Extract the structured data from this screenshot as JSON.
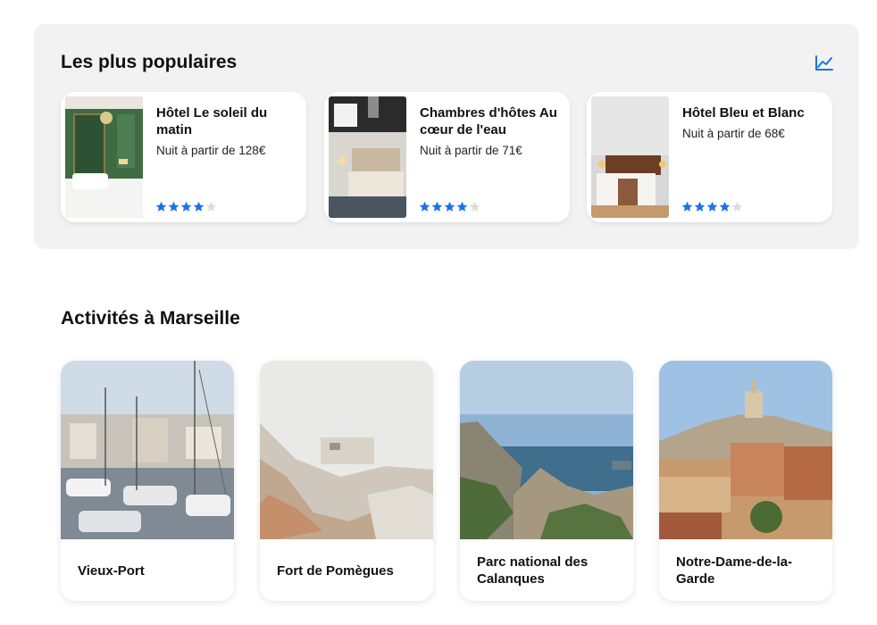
{
  "popular": {
    "title": "Les plus populaires",
    "chart_icon": "chart-line-icon",
    "hotels": [
      {
        "name": "Hôtel Le soleil du matin",
        "price": "Nuit à partir de 128€",
        "stars": 4,
        "max_stars": 5
      },
      {
        "name": "Chambres d'hôtes Au cœur de l'eau",
        "price": "Nuit à partir de 71€",
        "stars": 4,
        "max_stars": 5
      },
      {
        "name": "Hôtel Bleu et Blanc",
        "price": "Nuit à partir de 68€",
        "stars": 4,
        "max_stars": 5
      }
    ]
  },
  "activities": {
    "title": "Activités à Marseille",
    "items": [
      {
        "name": "Vieux-Port"
      },
      {
        "name": "Fort de Pomègues"
      },
      {
        "name": "Parc national des Calanques"
      },
      {
        "name": "Notre-Dame-de-la-Garde"
      }
    ]
  },
  "colors": {
    "accent": "#1a73e8",
    "panel_bg": "#f2f2f2",
    "star_empty": "#dddddd"
  }
}
